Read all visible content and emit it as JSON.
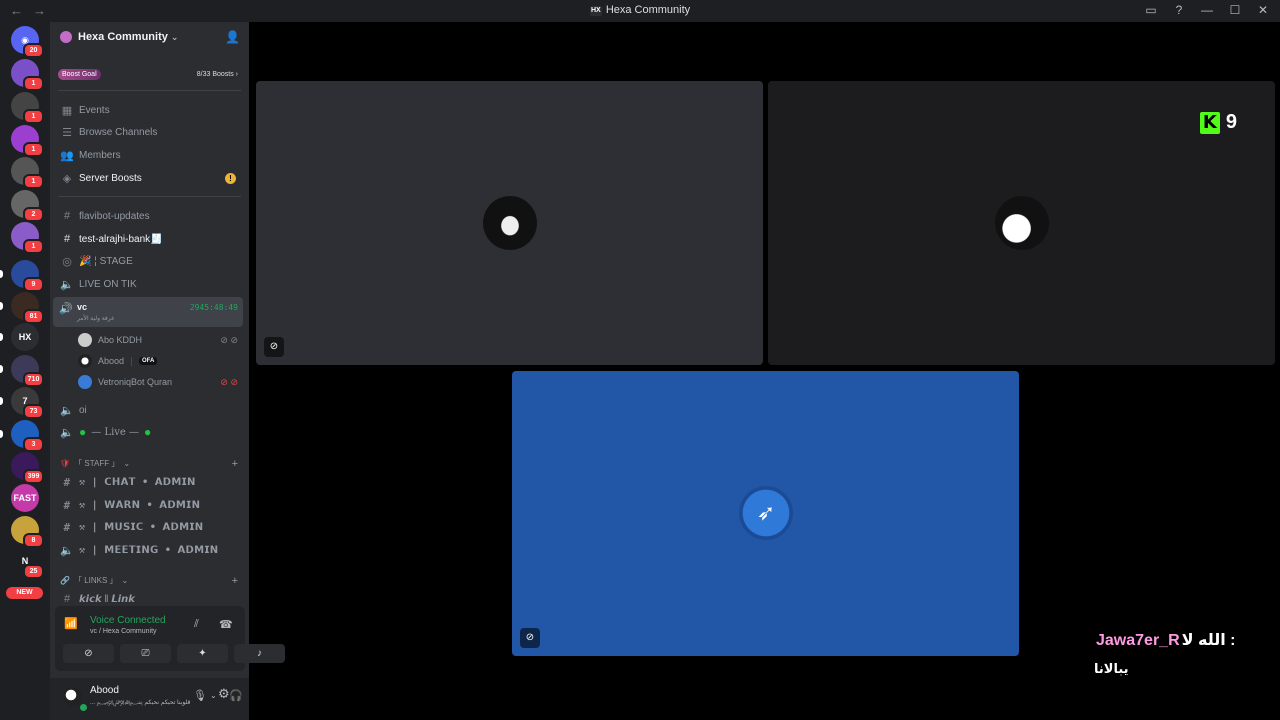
{
  "window": {
    "title": "Hexa Community",
    "title_icon": "HX"
  },
  "rail": {
    "home_badge": "20",
    "servers": [
      {
        "badge": "1",
        "color": "#7b4fc8"
      },
      {
        "badge": "1",
        "color": "#444"
      },
      {
        "badge": "1",
        "color": "#9b3fd0"
      },
      {
        "badge": "1",
        "color": "#555"
      },
      {
        "badge": "2",
        "color": "#666"
      },
      {
        "badge": "1",
        "color": "#8a5cc8"
      },
      {
        "badge": "9",
        "color": "#2a4a9c"
      },
      {
        "badge": "81",
        "color": "#3a2a22"
      },
      {
        "badge": "",
        "color": "#2b2d31",
        "label": "HX"
      },
      {
        "badge": "710",
        "color": "#3b3a58"
      },
      {
        "badge": "73",
        "color": "#3a3a3a",
        "label": "7"
      },
      {
        "badge": "3",
        "color": "#1f5fbf"
      },
      {
        "badge": "399",
        "color": "#3a1a5a"
      },
      {
        "badge": "",
        "color": "#c43aa8",
        "label": "FAST"
      },
      {
        "badge": "8",
        "color": "#c8a23a"
      },
      {
        "badge": "25",
        "color": "#1e1f22",
        "label": "N"
      }
    ],
    "new_label": "NEW"
  },
  "server": {
    "name": "Hexa Community",
    "boost_goal_label": "Boost Goal",
    "boost_count": "8/33 Boosts"
  },
  "nav": [
    {
      "label": "Events",
      "icon": "calendar-icon"
    },
    {
      "label": "Browse Channels",
      "icon": "browse-icon"
    },
    {
      "label": "Members",
      "icon": "members-icon"
    },
    {
      "label": "Server Boosts",
      "icon": "boost-icon"
    }
  ],
  "channels": {
    "flavibot": "flavibot-updates",
    "test_bank": "test-alrajhi-bank🧾",
    "stage": "🎉 ¦ STAGE",
    "live_tik": "LIVE ON TIK",
    "vc": {
      "name": "vc",
      "subtitle": "غرفة ولية الأمر",
      "timer": "2945:48:49"
    },
    "vc_users": [
      {
        "name": "Abo KDDH",
        "tag": ""
      },
      {
        "name": "Abood",
        "tag": "OFA",
        "prefix": "｜"
      },
      {
        "name": "VetroniqBot Quran",
        "tag": ""
      }
    ],
    "oi": "oi",
    "live": "— Live —"
  },
  "staff": {
    "category": "「 STAFF 」",
    "channels": [
      "⚒ | 𝗖𝗛𝗔𝗧 • 𝗔𝗗𝗠𝗜𝗡",
      "⚒ | 𝗪𝗔𝗥𝗡 • 𝗔𝗗𝗠𝗜𝗡",
      "⚒ | 𝗠𝗨𝗦𝗜𝗖 • 𝗔𝗗𝗠𝗜𝗡",
      "⚒ | 𝗠𝗘𝗘𝗧𝗜𝗡𝗚 • 𝗔𝗗𝗠𝗜𝗡"
    ]
  },
  "links": {
    "category": "「 LINKS 」",
    "kick": "𝙠𝙞𝙘𝙠 ‖ 𝙇𝙞𝙣𝙠"
  },
  "voice": {
    "status": "Voice Connected",
    "location": "vc / Hexa Community"
  },
  "user": {
    "name": "Abood",
    "status": "... ﷽ قلوبنا تحبكم نحبكم"
  },
  "stage": {
    "kick_viewers": "9",
    "kick_letter": "K",
    "overlay_prefix": "الله لا :",
    "overlay_name": "Jawa7er_R",
    "overlay_line2": "يبالانا"
  }
}
